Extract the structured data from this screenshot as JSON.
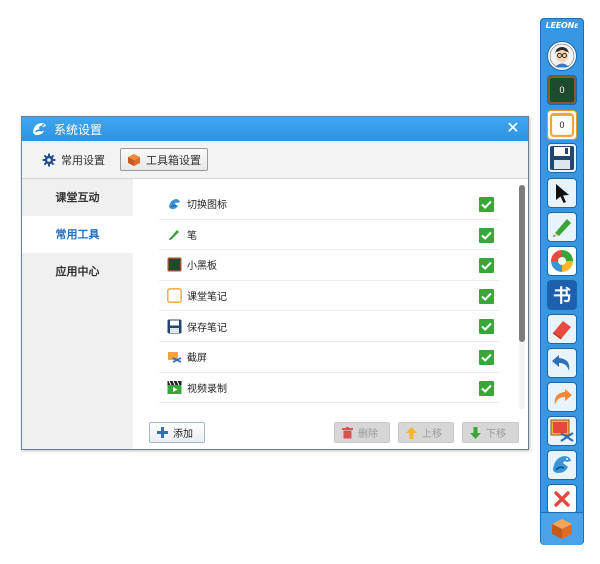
{
  "window": {
    "title": "系统设置",
    "close_glyph": "✕",
    "tabs": [
      {
        "label": "常用设置",
        "icon": "gear-icon"
      },
      {
        "label": "工具箱设置",
        "icon": "cube-box-icon"
      }
    ],
    "sidebar": [
      {
        "label": "课堂互动",
        "active": false
      },
      {
        "label": "常用工具",
        "active": true
      },
      {
        "label": "应用中心",
        "active": false
      }
    ],
    "tools": [
      {
        "label": "切换图标",
        "icon": "switch-bird-icon",
        "checked": true
      },
      {
        "label": "笔",
        "icon": "pen-icon",
        "checked": true
      },
      {
        "label": "小黑板",
        "icon": "blackboard-icon",
        "checked": true
      },
      {
        "label": "课堂笔记",
        "icon": "notepad-icon",
        "checked": true
      },
      {
        "label": "保存笔记",
        "icon": "floppy-disk-icon",
        "checked": true
      },
      {
        "label": "截屏",
        "icon": "screenshot-icon",
        "checked": true
      },
      {
        "label": "视频录制",
        "icon": "video-clapper-icon",
        "checked": true
      }
    ],
    "buttons": {
      "add": "添加",
      "delete": "删除",
      "move_up": "上移",
      "move_down": "下移"
    }
  },
  "toolbar": {
    "brand": "LEEONε",
    "blackboard_count": "0",
    "notes_count": "0",
    "items": [
      "avatar-icon",
      "blackboard-icon",
      "notepad-icon",
      "floppy-disk-icon",
      "cursor-arrow-icon",
      "pen-icon",
      "pie-chart-icon",
      "book-icon",
      "eraser-icon",
      "undo-icon",
      "redo-icon",
      "screenshot-icon",
      "switch-bird-icon",
      "close-icon",
      "cube-box-icon"
    ]
  },
  "colors": {
    "title_bar": "#2e93e3",
    "check_green": "#3aa63a",
    "active_sidebar_text": "#2b6fb8",
    "toolbar_blue": "#3897e3"
  }
}
